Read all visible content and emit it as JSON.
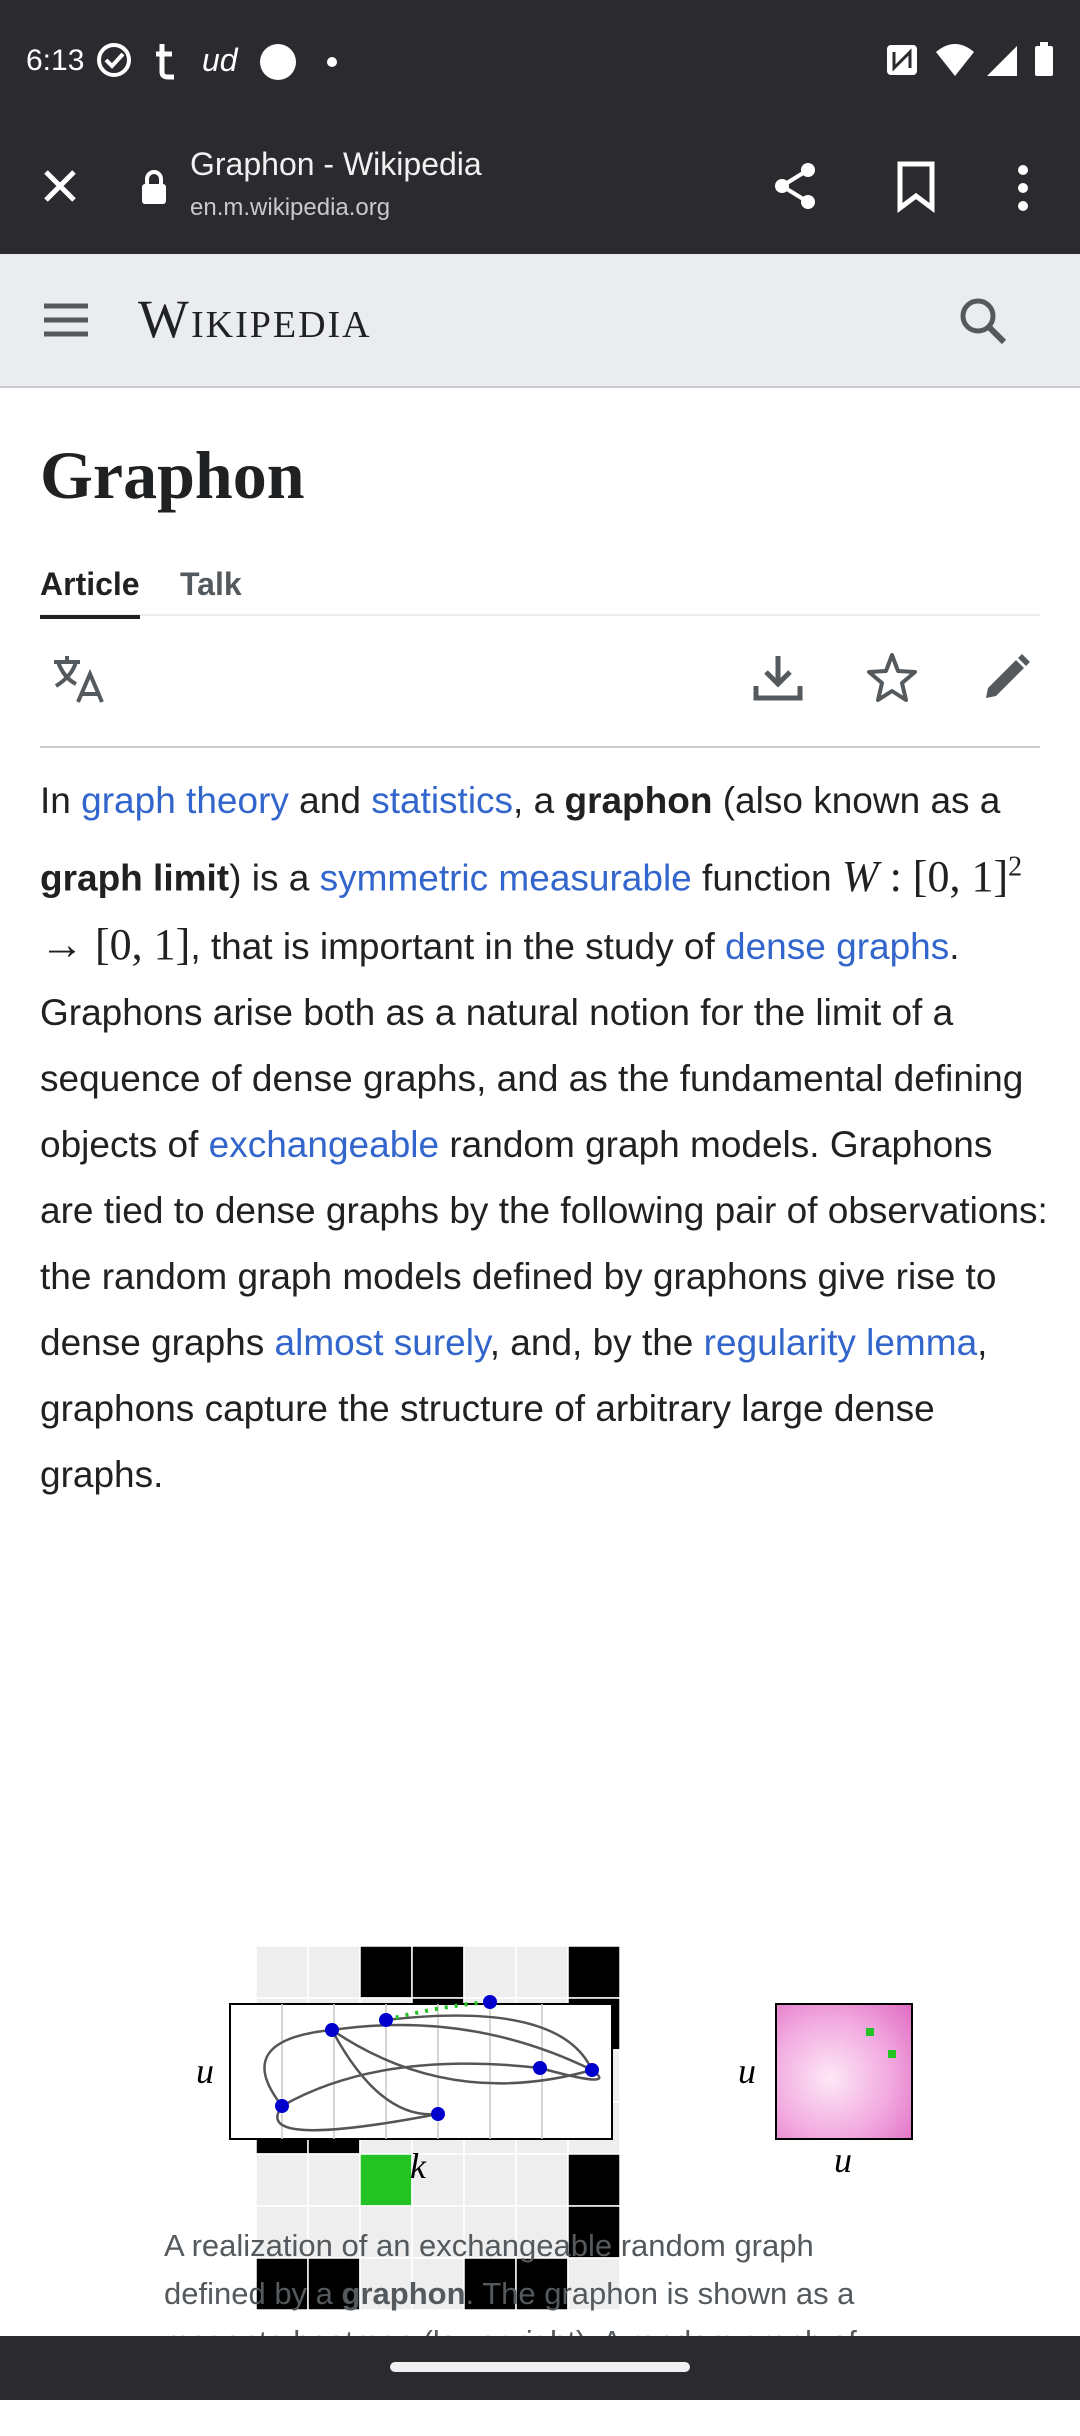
{
  "status_bar": {
    "time": "6:13",
    "notification_icons": [
      "check-circle-icon",
      "tumblr-icon",
      "ud-icon",
      "circle-icon",
      "dot-icon"
    ],
    "system_icons": [
      "nfc-icon",
      "wifi-icon",
      "signal-icon",
      "battery-icon"
    ],
    "ud_label": "ud"
  },
  "browser": {
    "page_title": "Graphon - Wikipedia",
    "url": "en.m.wikipedia.org"
  },
  "wiki_header": {
    "wordmark": "Wikipedia"
  },
  "article": {
    "title": "Graphon",
    "tabs": [
      {
        "label": "Article",
        "active": true
      },
      {
        "label": "Talk",
        "active": false
      }
    ],
    "paragraph": {
      "t1": "In ",
      "l1": "graph theory",
      "t2": " and ",
      "l2": "statistics",
      "t3": ", a ",
      "b1": "graphon",
      "t4": " (also known as a ",
      "b2": "graph limit",
      "t5": ") is a ",
      "l3": "symmetric",
      "t6": " ",
      "l4": "measurable",
      "t7": " function ",
      "math_w": "W",
      "math_rest": " : [0, 1]",
      "math_exp": "2",
      "math_tail": " → [0, 1]",
      "t8": ", that is important in the study of ",
      "l5": "dense graphs",
      "t9": ". Graphons arise both as a natural notion for the limit of a sequence of dense graphs, and as the fundamental defining objects of ",
      "l6": "exchangeable",
      "t10": " random graph models. Graphons are tied to dense graphs by the following pair of observations: the random graph models defined by graphons give rise to dense graphs ",
      "l7": "almost surely",
      "t11": ", and, by the ",
      "l8": "regularity lemma",
      "t12": ", graphons capture the structure of arbitrary large dense graphs."
    },
    "figure": {
      "matrix": [
        [
          0,
          0,
          1,
          1,
          0,
          0,
          1
        ],
        [
          0,
          0,
          0,
          1,
          0,
          0,
          1
        ],
        [
          1,
          0,
          0,
          0,
          2,
          0,
          0
        ],
        [
          1,
          1,
          0,
          0,
          0,
          0,
          0
        ],
        [
          0,
          0,
          2,
          0,
          0,
          0,
          1
        ],
        [
          0,
          0,
          0,
          0,
          0,
          0,
          1
        ],
        [
          1,
          1,
          0,
          0,
          1,
          1,
          0
        ]
      ],
      "label_u": "u",
      "label_k": "k",
      "colors": {
        "black": "#000000",
        "light": "#eeeeee",
        "green": "#22c322",
        "node": "#0000cc",
        "magenta": "#e97fd0"
      }
    },
    "caption": {
      "c1": "A realization of an exchangeable random graph defined by a ",
      "c2": "graphon",
      "c3": ". The graphon is shown as a magenta heatmap (lower right). A random graph of"
    }
  }
}
